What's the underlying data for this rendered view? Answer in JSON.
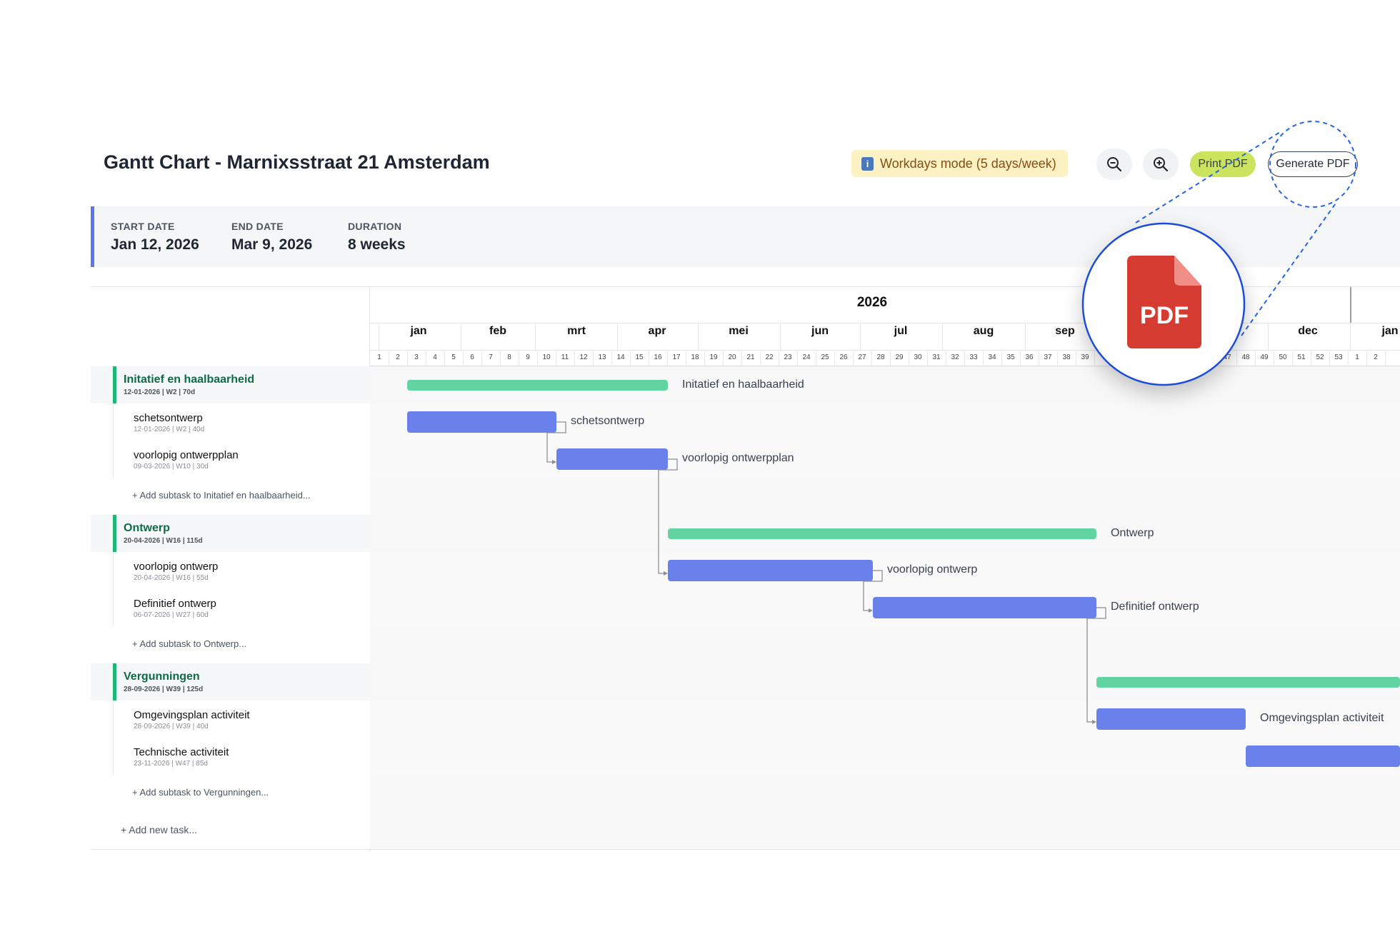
{
  "header": {
    "title": "Gantt Chart - Marnixsstraat 21 Amsterdam",
    "mode_badge": "Workdays mode (5 days/week)",
    "print_label": "Print PDF",
    "generate_label": "Generate PDF"
  },
  "summary": {
    "start_label": "START DATE",
    "start_value": "Jan 12, 2026",
    "end_label": "END DATE",
    "end_value": "Mar 9, 2026",
    "duration_label": "DURATION",
    "duration_value": "8 weeks"
  },
  "timeline": {
    "year": "2026",
    "months": [
      "jan",
      "feb",
      "mrt",
      "apr",
      "mei",
      "jun",
      "jul",
      "aug",
      "sep",
      "dec",
      "jan"
    ],
    "weeks": [
      "1",
      "2",
      "3",
      "4",
      "5",
      "6",
      "7",
      "8",
      "9",
      "10",
      "11",
      "12",
      "13",
      "14",
      "15",
      "16",
      "17",
      "18",
      "19",
      "20",
      "21",
      "22",
      "23",
      "24",
      "25",
      "26",
      "27",
      "28",
      "29",
      "30",
      "31",
      "32",
      "33",
      "34",
      "35",
      "36",
      "37",
      "38",
      "39",
      "47",
      "48",
      "49",
      "50",
      "51",
      "52",
      "53",
      "1",
      "2"
    ]
  },
  "groups": [
    {
      "name": "Initatief en haalbaarheid",
      "meta": "12-01-2026 | W2 | 70d",
      "bar_label": "Initatief en haalbaarheid",
      "tasks": [
        {
          "name": "schetsontwerp",
          "meta": "12-01-2026 | W2 | 40d",
          "bar_label": "schetsontwerp"
        },
        {
          "name": "voorlopig ontwerpplan",
          "meta": "09-03-2026 | W10 | 30d",
          "bar_label": "voorlopig ontwerpplan"
        }
      ],
      "add_subtask": "+ Add subtask to Initatief en haalbaarheid..."
    },
    {
      "name": "Ontwerp",
      "meta": "20-04-2026 | W16 | 115d",
      "bar_label": "Ontwerp",
      "tasks": [
        {
          "name": "voorlopig ontwerp",
          "meta": "20-04-2026 | W16 | 55d",
          "bar_label": "voorlopig ontwerp"
        },
        {
          "name": "Definitief ontwerp",
          "meta": "06-07-2026 | W27 | 60d",
          "bar_label": "Definitief ontwerp"
        }
      ],
      "add_subtask": "+ Add subtask to Ontwerp..."
    },
    {
      "name": "Vergunningen",
      "meta": "28-09-2026 | W39 | 125d",
      "bar_label": "",
      "tasks": [
        {
          "name": "Omgevingsplan activiteit",
          "meta": "28-09-2026 | W39 | 40d",
          "bar_label": "Omgevingsplan activiteit"
        },
        {
          "name": "Technische activiteit",
          "meta": "23-11-2026 | W47 | 85d",
          "bar_label": ""
        }
      ],
      "add_subtask": "+ Add subtask to Vergunningen..."
    }
  ],
  "add_task": "+ Add new task...",
  "magnifier": {
    "icon_text": "PDF"
  },
  "colors": {
    "task_bar": "#6a80ea",
    "group_bar": "#62d4a1",
    "group_accent": "#1fb67a",
    "print_btn": "#cbe45f",
    "pdf_red": "#d63b32"
  }
}
